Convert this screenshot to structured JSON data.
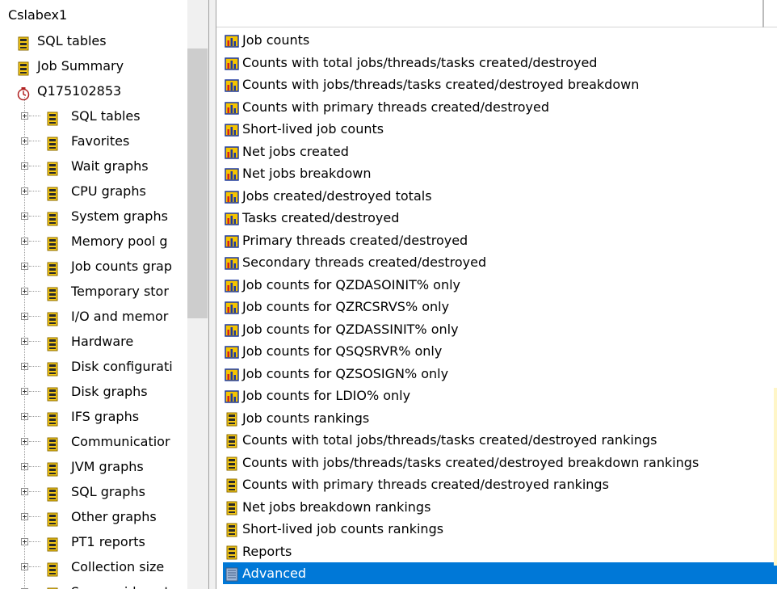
{
  "tree": {
    "root_label": "Cslabex1",
    "top_items": [
      {
        "label": "SQL tables",
        "icon": "folder-icon"
      },
      {
        "label": "Job Summary",
        "icon": "folder-icon"
      },
      {
        "label": "Q175102853",
        "icon": "collection-icon"
      }
    ],
    "child_items": [
      {
        "label": "SQL tables"
      },
      {
        "label": "Favorites"
      },
      {
        "label": "Wait graphs"
      },
      {
        "label": "CPU graphs"
      },
      {
        "label": "System graphs"
      },
      {
        "label": "Memory pool g"
      },
      {
        "label": "Job counts grap"
      },
      {
        "label": "Temporary stor"
      },
      {
        "label": "I/O and memor"
      },
      {
        "label": "Hardware"
      },
      {
        "label": "Disk configurati"
      },
      {
        "label": "Disk graphs"
      },
      {
        "label": "IFS graphs"
      },
      {
        "label": "Communicatior"
      },
      {
        "label": "JVM graphs"
      },
      {
        "label": "SQL graphs"
      },
      {
        "label": "Other graphs"
      },
      {
        "label": "PT1 reports"
      },
      {
        "label": "Collection size"
      },
      {
        "label": "Server side outp"
      }
    ]
  },
  "list": {
    "items": [
      {
        "label": "Job counts",
        "icon": "chart-icon"
      },
      {
        "label": "Counts with total jobs/threads/tasks created/destroyed",
        "icon": "chart-icon"
      },
      {
        "label": "Counts with jobs/threads/tasks created/destroyed breakdown",
        "icon": "chart-icon"
      },
      {
        "label": "Counts with primary threads created/destroyed",
        "icon": "chart-icon"
      },
      {
        "label": "Short-lived job counts",
        "icon": "chart-icon"
      },
      {
        "label": "Net jobs created",
        "icon": "chart-icon"
      },
      {
        "label": "Net jobs breakdown",
        "icon": "chart-icon"
      },
      {
        "label": "Jobs created/destroyed totals",
        "icon": "chart-icon"
      },
      {
        "label": "Tasks created/destroyed",
        "icon": "chart-icon"
      },
      {
        "label": "Primary threads created/destroyed",
        "icon": "chart-icon"
      },
      {
        "label": "Secondary threads created/destroyed",
        "icon": "chart-icon"
      },
      {
        "label": "Job counts for QZDASOINIT% only",
        "icon": "chart-icon"
      },
      {
        "label": "Job counts for QZRCSRVS% only",
        "icon": "chart-icon"
      },
      {
        "label": "Job counts for QZDASSINIT% only",
        "icon": "chart-icon"
      },
      {
        "label": "Job counts for QSQSRVR% only",
        "icon": "chart-icon"
      },
      {
        "label": "Job counts for QZSOSIGN% only",
        "icon": "chart-icon"
      },
      {
        "label": "Job counts for LDIO% only",
        "icon": "chart-icon"
      },
      {
        "label": "Job counts rankings",
        "icon": "folder-icon"
      },
      {
        "label": "Counts with total jobs/threads/tasks created/destroyed rankings",
        "icon": "folder-icon"
      },
      {
        "label": "Counts with jobs/threads/tasks created/destroyed breakdown rankings",
        "icon": "folder-icon"
      },
      {
        "label": "Counts with primary threads created/destroyed rankings",
        "icon": "folder-icon"
      },
      {
        "label": "Net jobs breakdown rankings",
        "icon": "folder-icon"
      },
      {
        "label": "Short-lived job counts rankings",
        "icon": "folder-icon"
      },
      {
        "label": "Reports",
        "icon": "folder-icon"
      },
      {
        "label": "Advanced",
        "icon": "advanced-icon"
      }
    ],
    "selected_label": "Advanced"
  },
  "colors": {
    "selection": "#0078d7",
    "folder_yellow": "#f5c400",
    "chart_blue": "#1e3aa0",
    "chart_red": "#d42020"
  }
}
